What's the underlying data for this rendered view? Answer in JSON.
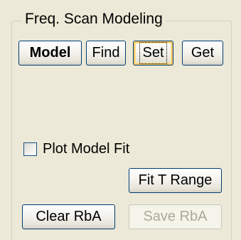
{
  "group": {
    "title": "Freq. Scan Modeling"
  },
  "buttons": {
    "model": "Model",
    "find": "Find",
    "set": "Set",
    "get": "Get",
    "fit_t_range": "Fit T Range",
    "clear_rba": "Clear RbA",
    "save_rba": "Save RbA"
  },
  "checkbox": {
    "label": "Plot Model Fit",
    "checked": false
  }
}
